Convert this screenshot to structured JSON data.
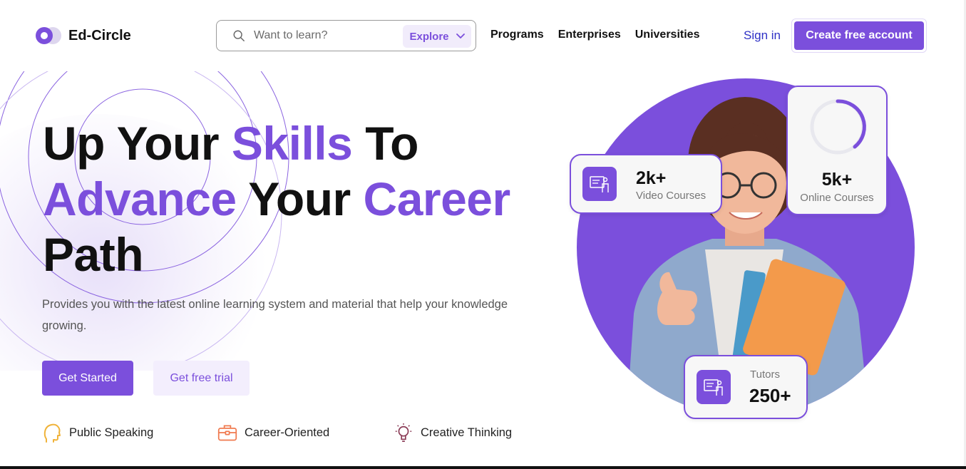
{
  "brand": {
    "name": "Ed-Circle"
  },
  "header": {
    "search_placeholder": "Want to learn?",
    "explore_label": "Explore",
    "nav": [
      "Programs",
      "Enterprises",
      "Universities"
    ],
    "signin": "Sign in",
    "cta": "Create free account"
  },
  "hero": {
    "headline": {
      "w1": "Up Your ",
      "w2": "Skills",
      "w3": " To",
      "w4": "Advance",
      "w5": " Your ",
      "w6": "Career",
      "w7": "Path"
    },
    "subtitle": "Provides you with the latest online learning system and material that help your knowledge growing.",
    "primary_button": "Get Started",
    "secondary_button": "Get free trial",
    "features": [
      {
        "label": "Public Speaking",
        "icon": "head-speaking-icon"
      },
      {
        "label": "Career-Oriented",
        "icon": "briefcase-icon"
      },
      {
        "label": "Creative Thinking",
        "icon": "lightbulb-icon"
      }
    ]
  },
  "stats": {
    "video": {
      "value": "2k+",
      "label": "Video Courses"
    },
    "online": {
      "value": "5k+",
      "label": "Online Courses"
    },
    "tutors": {
      "value": "250+",
      "label": "Tutors"
    }
  },
  "colors": {
    "accent": "#7b4fdc",
    "accent_soft": "#f3eefd",
    "link": "#2f31c6",
    "feature_yellow": "#f0b33a",
    "feature_orange": "#f07a4f",
    "feature_maroon": "#8a3a55"
  }
}
